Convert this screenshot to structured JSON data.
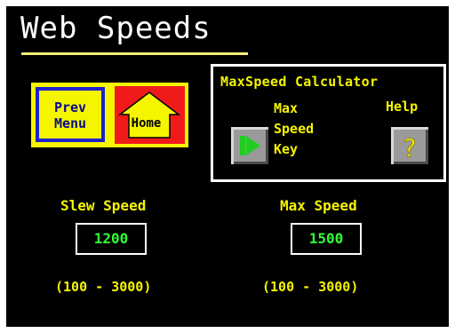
{
  "header": {
    "title": "Web Speeds"
  },
  "nav": {
    "prev_menu_line1": "Prev",
    "prev_menu_line2": "Menu",
    "home_label": "Home"
  },
  "calculator": {
    "title": "MaxSpeed Calculator",
    "key_label_line1": "Max",
    "key_label_line2": "Speed",
    "key_label_line3": "Key",
    "help_label": "Help",
    "help_glyph": "?"
  },
  "slew": {
    "label": "Slew Speed",
    "value": "1200",
    "range": "(100 - 3000)"
  },
  "max": {
    "label": "Max Speed",
    "value": "1500",
    "range": "(100 - 3000)"
  },
  "colors": {
    "background": "#000000",
    "label_yellow": "#f5f500",
    "value_green": "#33ff33",
    "home_red": "#f01a1a",
    "prev_border_blue": "#1e22c8"
  },
  "icons": {
    "play": "play-arrow-icon",
    "help": "question-mark-icon",
    "home": "house-icon"
  }
}
